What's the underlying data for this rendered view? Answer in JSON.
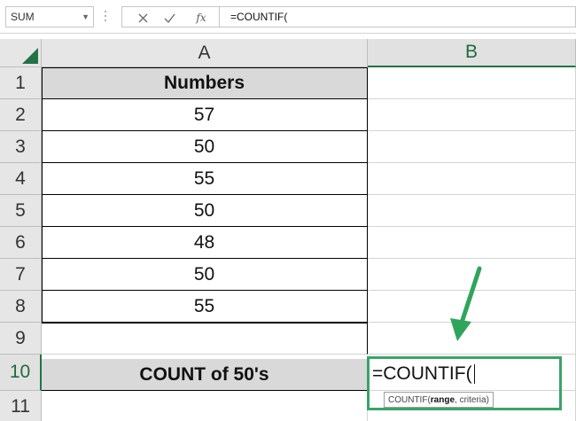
{
  "formula_bar": {
    "name_box": "SUM",
    "cancel_icon": "close-icon",
    "enter_icon": "checkmark-icon",
    "insert_function_label": "fx",
    "formula": "=COUNTIF("
  },
  "columns": [
    "A",
    "B"
  ],
  "rows": [
    "1",
    "2",
    "3",
    "4",
    "5",
    "6",
    "7",
    "8",
    "9",
    "10",
    "11"
  ],
  "column_a": {
    "header": "Numbers",
    "values": [
      "57",
      "50",
      "55",
      "50",
      "48",
      "50",
      "55"
    ],
    "summary_label": "COUNT of 50's"
  },
  "active_cell": {
    "text": "=COUNTIF(",
    "tooltip_function": "COUNTIF(",
    "tooltip_arg_current": "range",
    "tooltip_rest": ", criteria)"
  },
  "colors": {
    "accent_green": "#217346",
    "arrow_green": "#2fa55b",
    "header_fill": "#d9d9d9"
  }
}
